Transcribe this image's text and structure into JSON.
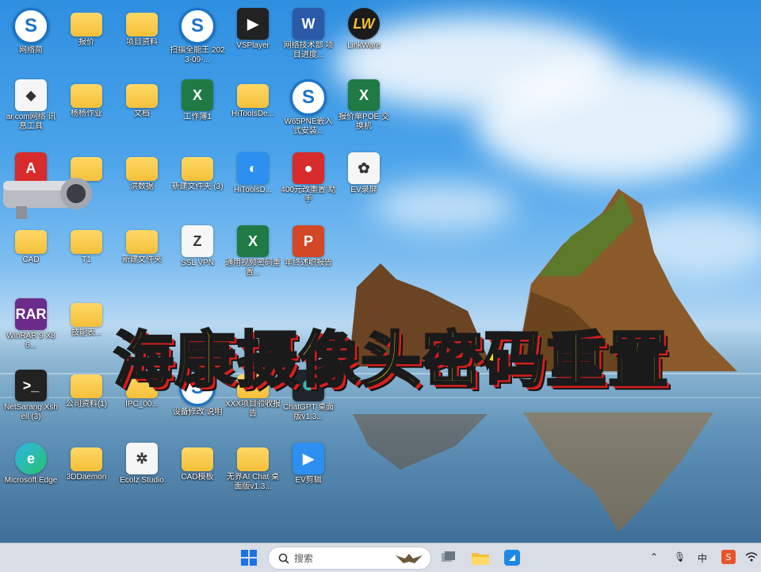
{
  "desktop": {
    "icons": [
      {
        "id": "wangluo",
        "label": "网络简"
      },
      {
        "id": "baojia",
        "label": "报价"
      },
      {
        "id": "xiangmuziliao",
        "label": "项目资料"
      },
      {
        "id": "sascan",
        "label": "扫描全能王 2023-09-..."
      },
      {
        "id": "vsplayer",
        "label": "VSPlayer"
      },
      {
        "id": "wangluo-doc",
        "label": "网络技术部 项目进度..."
      },
      {
        "id": "linkware",
        "label": "LinkWare"
      },
      {
        "id": "item-r2c1",
        "label": "ar.com网络 讯息工具"
      },
      {
        "id": "item-r2c2",
        "label": "杨杨作业"
      },
      {
        "id": "wendang",
        "label": "文档"
      },
      {
        "id": "gongzuobu",
        "label": "工作簿1"
      },
      {
        "id": "hitools",
        "label": "HiToolsDe..."
      },
      {
        "id": "w65pne",
        "label": "W65PNE嵌入式安装..."
      },
      {
        "id": "baojiadan",
        "label": "报价单POE 交换机"
      },
      {
        "id": "autocad",
        "label": ""
      },
      {
        "id": "item-r3c2",
        "label": ""
      },
      {
        "id": "hongshuju",
        "label": "洪数据"
      },
      {
        "id": "xinjian3",
        "label": "新建文件夹 (3)"
      },
      {
        "id": "hitoolsd",
        "label": "HiToolsD..."
      },
      {
        "id": "360",
        "label": "400元改重置 助手"
      },
      {
        "id": "evluping",
        "label": "EV录屏"
      },
      {
        "id": "cad",
        "label": "CAD"
      },
      {
        "id": "t1",
        "label": "T1"
      },
      {
        "id": "xinjianwenjianjia",
        "label": "新建文件夹"
      },
      {
        "id": "sslvpn",
        "label": "SSL VPN"
      },
      {
        "id": "tongyong",
        "label": "通用视频密码重置..."
      },
      {
        "id": "nianzhong",
        "label": "年终述职报告"
      },
      {
        "id": "rar",
        "label": "WinRAR 9 X86..."
      },
      {
        "id": "item-r5c2",
        "label": "技能表..."
      },
      {
        "id": "xshell",
        "label": "NetSarang Xshell (3)"
      },
      {
        "id": "item-r6c2",
        "label": "公司资料(1)"
      },
      {
        "id": "ipc",
        "label": "IPC_00..."
      },
      {
        "id": "baidu",
        "label": "设备修改 说明"
      },
      {
        "id": "xxx",
        "label": "XXX项目验收报告"
      },
      {
        "id": "chatgpt",
        "label": "ChatGPT 桌面版v1.3..."
      },
      {
        "id": "edge",
        "label": "Microsoft Edge"
      },
      {
        "id": "3dgemon",
        "label": "3DDaemon"
      },
      {
        "id": "ecoin",
        "label": "Ecolz Studio"
      },
      {
        "id": "cadmuban",
        "label": "CAD模板"
      },
      {
        "id": "chatgpt2",
        "label": "无界AI Chat 桌面版v1.3..."
      },
      {
        "id": "evjianji",
        "label": "EV剪辑"
      }
    ]
  },
  "overlay": {
    "title": "海康摄像头密码重置"
  },
  "taskbar": {
    "search_placeholder": "搜索",
    "ime_label": "中",
    "icons": [
      "windows-start-icon",
      "search-icon",
      "task-view-icon",
      "file-explorer-icon",
      "app-icon"
    ]
  },
  "colors": {
    "overlay_text": "#ffe11a",
    "overlay_shadow": "#d81e1e",
    "taskbar_bg": "#d8dde6"
  }
}
